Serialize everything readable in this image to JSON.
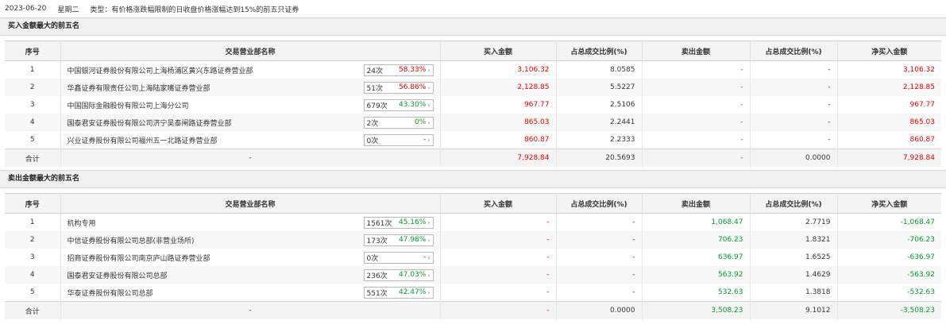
{
  "header": {
    "date": "2023-06-20",
    "weekday": "星期二",
    "type_text": "类型：有价格涨跌幅限制的日收盘价格涨幅达到15%的前五只证券"
  },
  "colors": {
    "red": "#e60000",
    "green": "#009933"
  },
  "columns": {
    "seq": "序号",
    "broker": "交易营业部名称",
    "buy": "买入金额",
    "buy_ratio": "占总成交比例(%)",
    "sell": "卖出金额",
    "sell_ratio": "占总成交比例(%)",
    "net": "净买入金额"
  },
  "buy_section": {
    "title": "买入金额最大的前五名",
    "rows": [
      {
        "seq": "1",
        "name": "中国银河证券股份有限公司上海杨浦区黄兴东路证券营业部",
        "count": "24次",
        "pct": "58.33%",
        "pct_color": "red",
        "buy": "3,106.32",
        "buy_ratio": "8.0585",
        "sell": "-",
        "sell_ratio": "-",
        "net": "3,106.32"
      },
      {
        "seq": "2",
        "name": "华鑫证券有限责任公司上海陆家嘴证券营业部",
        "count": "51次",
        "pct": "56.86%",
        "pct_color": "red",
        "buy": "2,128.85",
        "buy_ratio": "5.5227",
        "sell": "-",
        "sell_ratio": "-",
        "net": "2,128.85"
      },
      {
        "seq": "3",
        "name": "中国国际金融股份有限公司上海分公司",
        "count": "679次",
        "pct": "43.30%",
        "pct_color": "green",
        "buy": "967.77",
        "buy_ratio": "2.5106",
        "sell": "-",
        "sell_ratio": "-",
        "net": "967.77"
      },
      {
        "seq": "4",
        "name": "国泰君安证券股份有限公司济宁吴泰闸路证券营业部",
        "count": "2次",
        "pct": "0%",
        "pct_color": "green",
        "buy": "865.03",
        "buy_ratio": "2.2441",
        "sell": "-",
        "sell_ratio": "-",
        "net": "865.03"
      },
      {
        "seq": "5",
        "name": "兴业证券股份有限公司福州五一北路证券营业部",
        "count": "0次",
        "pct": "-",
        "pct_color": "gray",
        "buy": "860.87",
        "buy_ratio": "2.2333",
        "sell": "-",
        "sell_ratio": "-",
        "net": "860.87"
      }
    ],
    "total": {
      "label": "合计",
      "name": "-",
      "buy": "7,928.84",
      "buy_ratio": "20.5693",
      "sell": "-",
      "sell_ratio": "0.0000",
      "net": "7,928.84"
    }
  },
  "sell_section": {
    "title": "卖出金额最大的前五名",
    "rows": [
      {
        "seq": "1",
        "name": "机构专用",
        "count": "1561次",
        "pct": "45.16%",
        "pct_color": "green",
        "buy": "-",
        "buy_ratio": "-",
        "sell": "1,068.47",
        "sell_ratio": "2.7719",
        "net": "-1,068.47"
      },
      {
        "seq": "2",
        "name": "中信证券股份有限公司总部(非营业场所)",
        "count": "173次",
        "pct": "47.98%",
        "pct_color": "green",
        "buy": "-",
        "buy_ratio": "-",
        "sell": "706.23",
        "sell_ratio": "1.8321",
        "net": "-706.23"
      },
      {
        "seq": "3",
        "name": "招商证券股份有限公司南京庐山路证券营业部",
        "count": "0次",
        "pct": "-",
        "pct_color": "gray",
        "buy": "-",
        "buy_ratio": "-",
        "sell": "636.97",
        "sell_ratio": "1.6525",
        "net": "-636.97"
      },
      {
        "seq": "4",
        "name": "国泰君安证券股份有限公司总部",
        "count": "236次",
        "pct": "47.03%",
        "pct_color": "green",
        "buy": "-",
        "buy_ratio": "-",
        "sell": "563.92",
        "sell_ratio": "1.4629",
        "net": "-563.92"
      },
      {
        "seq": "5",
        "name": "华泰证券股份有限公司总部",
        "count": "551次",
        "pct": "42.47%",
        "pct_color": "green",
        "buy": "-",
        "buy_ratio": "-",
        "sell": "532.63",
        "sell_ratio": "1.3818",
        "net": "-532.63"
      }
    ],
    "total": {
      "label": "合计",
      "name": "-",
      "buy": "-",
      "buy_ratio": "0.0000",
      "sell": "3,508.23",
      "sell_ratio": "9.1012",
      "net": "-3,508.23"
    }
  }
}
